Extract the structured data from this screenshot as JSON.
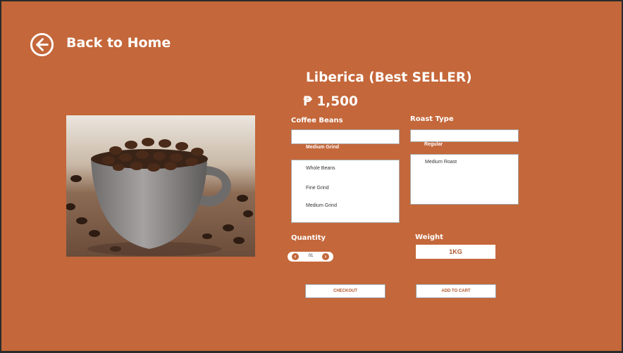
{
  "nav": {
    "back_label": "Back to Home"
  },
  "product": {
    "title": "Liberica (Best SELLER)",
    "price": "₱ 1,500"
  },
  "coffee_beans": {
    "label": "Coffee Beans",
    "selected": "Medium Grind",
    "options": [
      "Whole Beans",
      "Fine Grind",
      "Medium Grind"
    ]
  },
  "roast_type": {
    "label": "Roast Type",
    "selected": "Regular",
    "options": [
      "Medium Roast"
    ]
  },
  "quantity": {
    "label": "Quantity",
    "value": "01"
  },
  "weight": {
    "label": "Weight",
    "value": "1KG"
  },
  "actions": {
    "checkout": "CHECKOUT",
    "add_to_cart": "ADD TO CART"
  },
  "colors": {
    "background": "#c4673a",
    "accent": "#b5562c",
    "text": "#ffffff"
  },
  "icons": {
    "back": "arrow-left-circle-icon",
    "decrement": "chevron-left-icon",
    "increment": "chevron-right-icon"
  }
}
